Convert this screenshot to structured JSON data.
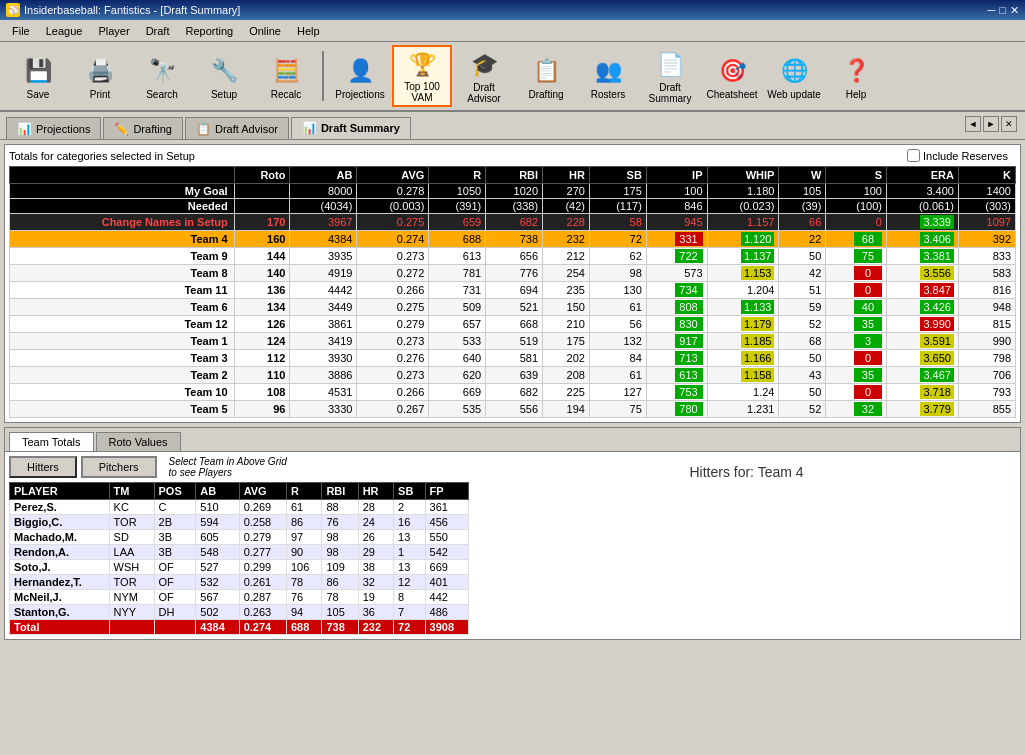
{
  "window": {
    "title": "Insiderbaseball: Fantistics - [Draft Summary]"
  },
  "menu": {
    "items": [
      "File",
      "League",
      "Player",
      "Draft",
      "Reporting",
      "Online",
      "Help"
    ]
  },
  "toolbar": {
    "buttons": [
      {
        "label": "Save",
        "icon": "💾"
      },
      {
        "label": "Print",
        "icon": "🖨️"
      },
      {
        "label": "Search",
        "icon": "🔭"
      },
      {
        "label": "Setup",
        "icon": "🔧"
      },
      {
        "label": "Recalc",
        "icon": "📊"
      },
      {
        "label": "Projections",
        "icon": "👤"
      },
      {
        "label": "Top 100 VAM",
        "icon": "🏆"
      },
      {
        "label": "Draft Advisor",
        "icon": "🎓"
      },
      {
        "label": "Drafting",
        "icon": "📋"
      },
      {
        "label": "Rosters",
        "icon": "👥"
      },
      {
        "label": "Draft Summary",
        "icon": "📄"
      },
      {
        "label": "Cheatsheet",
        "icon": "🎯"
      },
      {
        "label": "Web update",
        "icon": "🌐"
      },
      {
        "label": "Help",
        "icon": "❓"
      }
    ]
  },
  "tabs": [
    {
      "label": "Projections",
      "icon": "📊",
      "active": false
    },
    {
      "label": "Drafting",
      "icon": "✏️",
      "active": false
    },
    {
      "label": "Draft Advisor",
      "icon": "📋",
      "active": false
    },
    {
      "label": "Draft Summary",
      "icon": "📊",
      "active": true
    }
  ],
  "options": {
    "setup_text": "Totals for categories selected in Setup",
    "include_reserves": "Include Reserves"
  },
  "summary_table": {
    "headers": [
      "",
      "Roto",
      "AB",
      "AVG",
      "R",
      "RBI",
      "HR",
      "SB",
      "IP",
      "WHIP",
      "W",
      "S",
      "ERA",
      "K"
    ],
    "rows": [
      {
        "name": "My Goal",
        "roto": "",
        "ab": "8000",
        "avg": "0.278",
        "r": "1050",
        "rbi": "1020",
        "hr": "270",
        "sb": "175",
        "ip": "100",
        "whip": "1.180",
        "w": "105",
        "s": "100",
        "era": "3.400",
        "k": "1400",
        "type": "mygoal"
      },
      {
        "name": "Needed",
        "roto": "",
        "ab": "(4034)",
        "avg": "(0.003)",
        "r": "(391)",
        "rbi": "(338)",
        "hr": "(42)",
        "sb": "(117)",
        "ip": "846",
        "whip": "(0.023)",
        "w": "(39)",
        "s": "(100)",
        "era": "(0.061)",
        "k": "(303)",
        "type": "needed"
      },
      {
        "name": "Change Names in Setup",
        "roto": "170",
        "ab": "3967",
        "avg": "0.275",
        "r": "659",
        "rbi": "682",
        "hr": "228",
        "sb": "58",
        "ip_col": "945",
        "whip": "1.157",
        "w": "66",
        "s": "0",
        "era": "3.339",
        "k": "1097",
        "type": "change"
      },
      {
        "name": "Team 4",
        "roto": "160",
        "ab": "4384",
        "avg": "0.274",
        "r": "688",
        "rbi": "738",
        "hr": "232",
        "sb": "72",
        "ip_col": "331",
        "whip": "1.120",
        "w": "22",
        "s": "68",
        "era": "3.406",
        "k": "392",
        "type": "team4"
      },
      {
        "name": "Team 9",
        "roto": "144",
        "ab": "3935",
        "avg": "0.273",
        "r": "613",
        "rbi": "656",
        "hr": "212",
        "sb": "62",
        "ip_col": "722",
        "whip": "1.137",
        "w": "50",
        "s": "75",
        "era": "3.381",
        "k": "833",
        "type": "normal"
      },
      {
        "name": "Team 8",
        "roto": "140",
        "ab": "4919",
        "avg": "0.272",
        "r": "781",
        "rbi": "776",
        "hr": "254",
        "sb": "98",
        "ip_col": "573",
        "whip": "1.153",
        "w": "42",
        "s": "0",
        "era": "3.556",
        "k": "583",
        "type": "normal"
      },
      {
        "name": "Team 11",
        "roto": "136",
        "ab": "4442",
        "avg": "0.266",
        "r": "731",
        "rbi": "694",
        "hr": "235",
        "sb": "130",
        "ip_col": "734",
        "whip": "1.204",
        "w": "51",
        "s": "0",
        "era": "3.847",
        "k": "816",
        "type": "normal"
      },
      {
        "name": "Team 6",
        "roto": "134",
        "ab": "3449",
        "avg": "0.275",
        "r": "509",
        "rbi": "521",
        "hr": "150",
        "sb": "61",
        "ip_col": "808",
        "whip": "1.133",
        "w": "59",
        "s": "40",
        "era": "3.426",
        "k": "948",
        "type": "normal"
      },
      {
        "name": "Team 12",
        "roto": "126",
        "ab": "3861",
        "avg": "0.279",
        "r": "657",
        "rbi": "668",
        "hr": "210",
        "sb": "56",
        "ip_col": "830",
        "whip": "1.179",
        "w": "52",
        "s": "35",
        "era": "3.990",
        "k": "815",
        "type": "normal"
      },
      {
        "name": "Team 1",
        "roto": "124",
        "ab": "3419",
        "avg": "0.273",
        "r": "533",
        "rbi": "519",
        "hr": "175",
        "sb": "132",
        "ip_col": "917",
        "whip": "1.185",
        "w": "68",
        "s": "3",
        "era": "3.591",
        "k": "990",
        "type": "normal"
      },
      {
        "name": "Team 3",
        "roto": "112",
        "ab": "3930",
        "avg": "0.276",
        "r": "640",
        "rbi": "581",
        "hr": "202",
        "sb": "84",
        "ip_col": "713",
        "whip": "1.166",
        "w": "50",
        "s": "0",
        "era": "3.650",
        "k": "798",
        "type": "normal"
      },
      {
        "name": "Team 2",
        "roto": "110",
        "ab": "3886",
        "avg": "0.273",
        "r": "620",
        "rbi": "639",
        "hr": "208",
        "sb": "61",
        "ip_col": "613",
        "whip": "1.158",
        "w": "43",
        "s": "35",
        "era": "3.467",
        "k": "706",
        "type": "normal"
      },
      {
        "name": "Team 10",
        "roto": "108",
        "ab": "4531",
        "avg": "0.266",
        "r": "669",
        "rbi": "682",
        "hr": "225",
        "sb": "127",
        "ip_col": "753",
        "whip": "1.24",
        "w": "50",
        "s": "0",
        "era": "3.718",
        "k": "793",
        "type": "normal"
      },
      {
        "name": "Team 5",
        "roto": "96",
        "ab": "3330",
        "avg": "0.267",
        "r": "535",
        "rbi": "556",
        "hr": "194",
        "sb": "75",
        "ip_col": "780",
        "whip": "1.231",
        "w": "52",
        "s": "32",
        "era": "3.779",
        "k": "855",
        "type": "normal"
      }
    ]
  },
  "bottom_tabs": [
    "Team Totals",
    "Roto Values"
  ],
  "active_bottom_tab": "Team Totals",
  "player_tabs": {
    "hitters_label": "Hitters",
    "pitchers_label": "Pitchers",
    "select_hint": "Select Team in Above Grid\nto see Players"
  },
  "team_label": "Hitters for: Team 4",
  "players_table": {
    "headers": [
      "PLAYER",
      "TM",
      "POS",
      "AB",
      "AVG",
      "R",
      "RBI",
      "HR",
      "SB",
      "FP"
    ],
    "rows": [
      {
        "player": "Perez,S.",
        "tm": "KC",
        "pos": "C",
        "ab": "510",
        "avg": "0.269",
        "r": "61",
        "rbi": "88",
        "hr": "28",
        "sb": "2",
        "fp": "361"
      },
      {
        "player": "Biggio,C.",
        "tm": "TOR",
        "pos": "2B",
        "ab": "594",
        "avg": "0.258",
        "r": "86",
        "rbi": "76",
        "hr": "24",
        "sb": "16",
        "fp": "456"
      },
      {
        "player": "Machado,M.",
        "tm": "SD",
        "pos": "3B",
        "ab": "605",
        "avg": "0.279",
        "r": "97",
        "rbi": "98",
        "hr": "26",
        "sb": "13",
        "fp": "550"
      },
      {
        "player": "Rendon,A.",
        "tm": "LAA",
        "pos": "3B",
        "ab": "548",
        "avg": "0.277",
        "r": "90",
        "rbi": "98",
        "hr": "29",
        "sb": "1",
        "fp": "542"
      },
      {
        "player": "Soto,J.",
        "tm": "WSH",
        "pos": "OF",
        "ab": "527",
        "avg": "0.299",
        "r": "106",
        "rbi": "109",
        "hr": "38",
        "sb": "13",
        "fp": "669"
      },
      {
        "player": "Hernandez,T.",
        "tm": "TOR",
        "pos": "OF",
        "ab": "532",
        "avg": "0.261",
        "r": "78",
        "rbi": "86",
        "hr": "32",
        "sb": "12",
        "fp": "401"
      },
      {
        "player": "McNeil,J.",
        "tm": "NYM",
        "pos": "OF",
        "ab": "567",
        "avg": "0.287",
        "r": "76",
        "rbi": "78",
        "hr": "19",
        "sb": "8",
        "fp": "442"
      },
      {
        "player": "Stanton,G.",
        "tm": "NYY",
        "pos": "DH",
        "ab": "502",
        "avg": "0.263",
        "r": "94",
        "rbi": "105",
        "hr": "36",
        "sb": "7",
        "fp": "486"
      }
    ],
    "total_row": {
      "player": "Total",
      "ab": "4384",
      "avg": "0.274",
      "r": "688",
      "rbi": "738",
      "hr": "232",
      "sb": "72",
      "fp": "3908"
    }
  }
}
